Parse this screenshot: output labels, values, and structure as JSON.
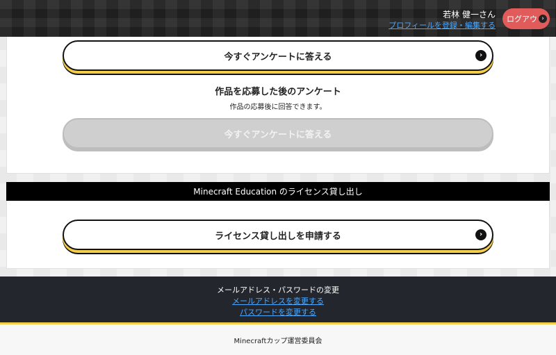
{
  "header": {
    "user_name": "若林 健一さん",
    "profile_link": "プロフィールを登録・編集する",
    "logout_label": "ログアウト",
    "logout_icon": "chevron-right-icon"
  },
  "survey": {
    "now_button": "今すぐアンケートに答える",
    "after_title": "作品を応募した後のアンケート",
    "after_subtitle": "作品の応募後に回答できます。",
    "after_button_disabled": "今すぐアンケートに答える"
  },
  "license": {
    "section_title": "Minecraft Education のライセンス貸し出し",
    "apply_button": "ライセンス貸し出しを申請する"
  },
  "account": {
    "title": "メールアドレス・パスワードの変更",
    "change_email": "メールアドレスを変更する",
    "change_password": "パスワードを変更する"
  },
  "footer": {
    "org": "Minecraftカップ運営委員会"
  },
  "colors": {
    "accent_gold": "#f4cd4a",
    "logout_red": "#e25b5b",
    "link_blue": "#4aa8ff",
    "dark_bg": "#23262d"
  }
}
